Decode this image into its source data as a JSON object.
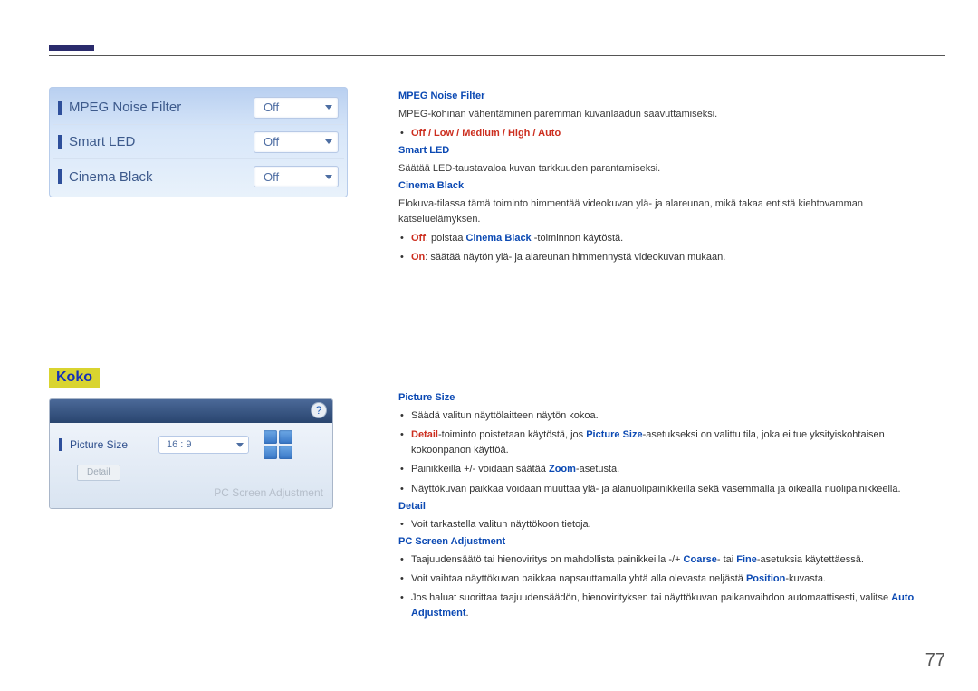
{
  "panel1": {
    "rows": [
      {
        "label": "MPEG Noise Filter",
        "value": "Off"
      },
      {
        "label": "Smart LED",
        "value": "Off"
      },
      {
        "label": "Cinema Black",
        "value": "Off"
      }
    ]
  },
  "panel2": {
    "help": "?",
    "ps_label": "Picture Size",
    "ps_value": "16 : 9",
    "detail_label": "Detail",
    "psa_label": "PC Screen Adjustment"
  },
  "koko_title": "Koko",
  "right_top": {
    "h_mpeg": "MPEG Noise Filter",
    "mpeg_body": "MPEG-kohinan vähentäminen paremman kuvanlaadun saavuttamiseksi.",
    "mpeg_opts": "Off / Low / Medium / High / Auto",
    "h_smart": "Smart LED",
    "smart_body": "Säätää LED-taustavaloa kuvan tarkkuuden parantamiseksi.",
    "h_cinema": "Cinema Black",
    "cinema_body": "Elokuva-tilassa tämä toiminto himmentää videokuvan ylä- ja alareunan, mikä takaa entistä kiehtovamman katseluelämyksen.",
    "cb_off_key": "Off",
    "cb_off_1": ": poistaa ",
    "cb_off_b": "Cinema Black",
    "cb_off_2": " -toiminnon käytöstä.",
    "cb_on_key": "On",
    "cb_on_body": ": säätää näytön ylä- ja alareunan himmennystä videokuvan mukaan."
  },
  "right_koko": {
    "h_ps": "Picture Size",
    "ps_b1": "Säädä valitun näyttölaitteen näytön kokoa.",
    "ps_b2_1": "Detail",
    "ps_b2_2": "-toiminto poistetaan käytöstä, jos ",
    "ps_b2_3": "Picture Size",
    "ps_b2_4": "-asetukseksi on valittu tila, joka ei tue yksityiskohtaisen kokoonpanon käyttöä.",
    "ps_b3_1": "Painikkeilla +/- voidaan säätää ",
    "ps_b3_2": "Zoom",
    "ps_b3_3": "-asetusta.",
    "ps_b4": "Näyttökuvan paikkaa voidaan muuttaa ylä- ja alanuolipainikkeilla sekä vasemmalla ja oikealla nuolipainikkeella.",
    "h_detail": "Detail",
    "detail_b1": "Voit tarkastella valitun näyttökoon tietoja.",
    "h_pcsa": "PC Screen Adjustment",
    "pcsa_b1_1": "Taajuudensäätö tai hienoviritys on mahdollista painikkeilla -/+ ",
    "pcsa_b1_2": "Coarse",
    "pcsa_b1_3": "- tai ",
    "pcsa_b1_4": "Fine",
    "pcsa_b1_5": "-asetuksia käytettäessä.",
    "pcsa_b2_1": "Voit vaihtaa näyttökuvan paikkaa napsauttamalla yhtä alla olevasta neljästä ",
    "pcsa_b2_2": "Position",
    "pcsa_b2_3": "-kuvasta.",
    "pcsa_b3_1": "Jos haluat suorittaa taajuudensäädön, hienovirityksen tai näyttökuvan paikanvaihdon automaattisesti, valitse ",
    "pcsa_b3_2": "Auto Adjustment",
    "pcsa_b3_3": "."
  },
  "page_number": "77"
}
